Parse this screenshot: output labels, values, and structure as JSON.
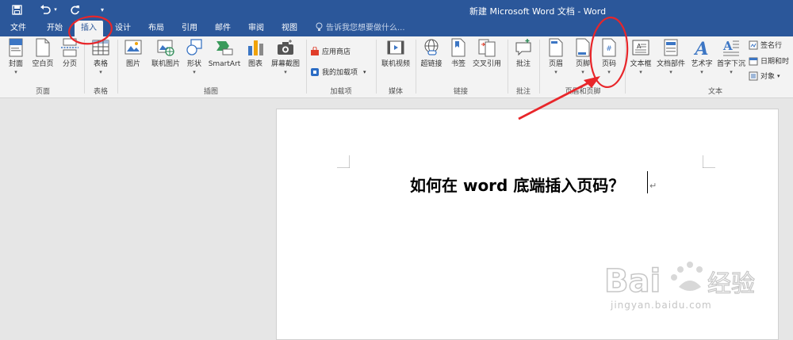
{
  "title": "新建 Microsoft Word 文档 - Word",
  "quick_access": {
    "save": "save-icon",
    "undo": "undo-icon",
    "redo": "redo-icon",
    "customize": "▾"
  },
  "tabs": [
    "文件",
    "开始",
    "插入",
    "设计",
    "布局",
    "引用",
    "邮件",
    "审阅",
    "视图"
  ],
  "active_tab": "插入",
  "tell_me": "告诉我您想要做什么...",
  "ribbon": {
    "pages": {
      "cover": "封面",
      "blank": "空白页",
      "break": "分页",
      "group": "页面"
    },
    "tables": {
      "table": "表格",
      "group": "表格"
    },
    "illustrations": {
      "pictures": "图片",
      "online_pictures": "联机图片",
      "shapes": "形状",
      "smartart": "SmartArt",
      "chart": "图表",
      "screenshot": "屏幕截图",
      "group": "插图"
    },
    "addins": {
      "store": "应用商店",
      "my_addins": "我的加载项",
      "group": "加载项"
    },
    "media": {
      "online_video": "联机视频",
      "group": "媒体"
    },
    "links": {
      "hyperlink": "超链接",
      "bookmark": "书签",
      "cross_ref": "交叉引用",
      "group": "链接"
    },
    "comments": {
      "comment": "批注",
      "group": "批注"
    },
    "header_footer": {
      "header": "页眉",
      "footer": "页脚",
      "page_number": "页码",
      "group": "页眉和页脚"
    },
    "text": {
      "textbox": "文本框",
      "quick_parts": "文档部件",
      "wordart": "艺术字",
      "dropcap": "首字下沉",
      "signature": "签名行",
      "datetime": "日期和时",
      "object": "对象",
      "group": "文本"
    }
  },
  "document": {
    "heading": "如何在 word 底端插入页码？"
  },
  "watermark": {
    "text": "jingyan.baidu.com"
  },
  "colors": {
    "titlebar": "#2b579a",
    "annotation": "#e8262a"
  }
}
